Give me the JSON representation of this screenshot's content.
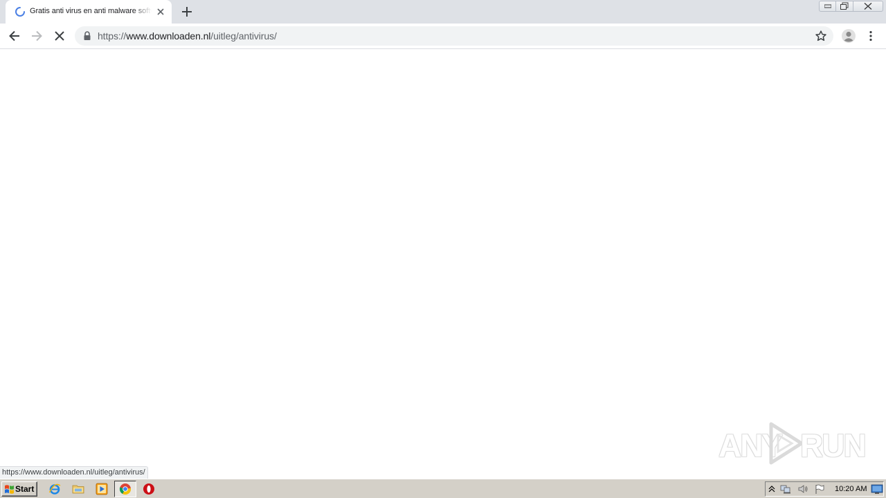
{
  "browser": {
    "tab": {
      "title": "Gratis anti virus en anti malware software",
      "spinner_color": "#4a7fe4"
    },
    "address_bar": {
      "url_scheme": "https://",
      "url_host": "www.downloaden.nl",
      "url_path": "/uitleg/antivirus/"
    },
    "status_url": "https://www.downloaden.nl/uitleg/antivirus/"
  },
  "watermark": {
    "left_text": "ANY",
    "right_text": "RUN"
  },
  "taskbar": {
    "start_label": "Start",
    "quick_launch": [
      "internet-explorer-icon",
      "windows-explorer-icon",
      "media-player-icon",
      "chrome-icon",
      "opera-icon"
    ],
    "clock": "10:20 AM"
  },
  "colors": {
    "tabstrip": "#dee1e6",
    "omnibox": "#f1f3f4",
    "taskbar": "#d4d0c8"
  }
}
